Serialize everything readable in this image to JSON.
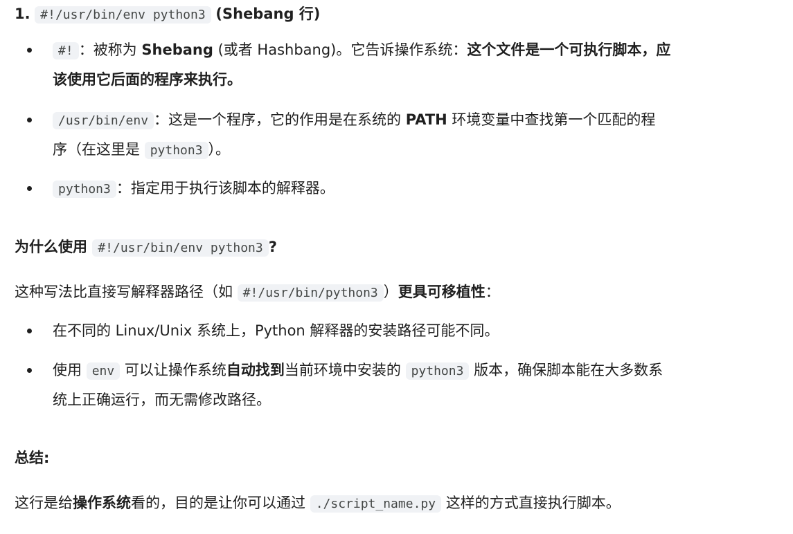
{
  "section1": {
    "number": "1.",
    "code": "#!/usr/bin/env python3",
    "title": "(Shebang 行)"
  },
  "bullets": {
    "b1": {
      "code": "#!",
      "sep": "：",
      "text1": "被称为 ",
      "bold1": "Shebang",
      "text2": " (或者 Hashbang)。它告诉操作系统：",
      "bold2": "这个文件是一个可执行脚本，应",
      "bold3": "该使用它后面的程序来执行。"
    },
    "b2": {
      "code": "/usr/bin/env",
      "sep": "：",
      "text1": "这是一个程序，它的作用是在系统的 ",
      "bold1": "PATH",
      "text2": " 环境变量中查找第一个匹配的程",
      "text3": "序（在这里是 ",
      "code2": "python3",
      "text4": "）。"
    },
    "b3": {
      "code": "python3",
      "sep": "：",
      "text1": "指定用于执行该脚本的解释器。"
    }
  },
  "why": {
    "title": "为什么使用 ",
    "code": "#!/usr/bin/env python3",
    "q": "?",
    "intro1": "这种写法比直接写解释器路径（如 ",
    "intro_code": "#!/usr/bin/python3",
    "intro2": "）",
    "intro_bold": "更具可移植性",
    "intro3": "：",
    "item1": "在不同的 Linux/Unix 系统上，Python 解释器的安装路径可能不同。",
    "item2": {
      "text1": "使用 ",
      "code1": "env",
      "text2": " 可以让操作系统",
      "bold1": "自动找到",
      "text3": "当前环境中安装的 ",
      "code2": "python3",
      "text4": " 版本，确保脚本能在大多数系",
      "text5": "统上正确运行，而无需修改路径。"
    }
  },
  "summary": {
    "title": "总结:",
    "text1": "这行是给",
    "bold1": "操作系统",
    "text2": "看的，目的是让你可以通过 ",
    "code": "./script_name.py",
    "text3": " 这样的方式直接执行脚本。"
  }
}
